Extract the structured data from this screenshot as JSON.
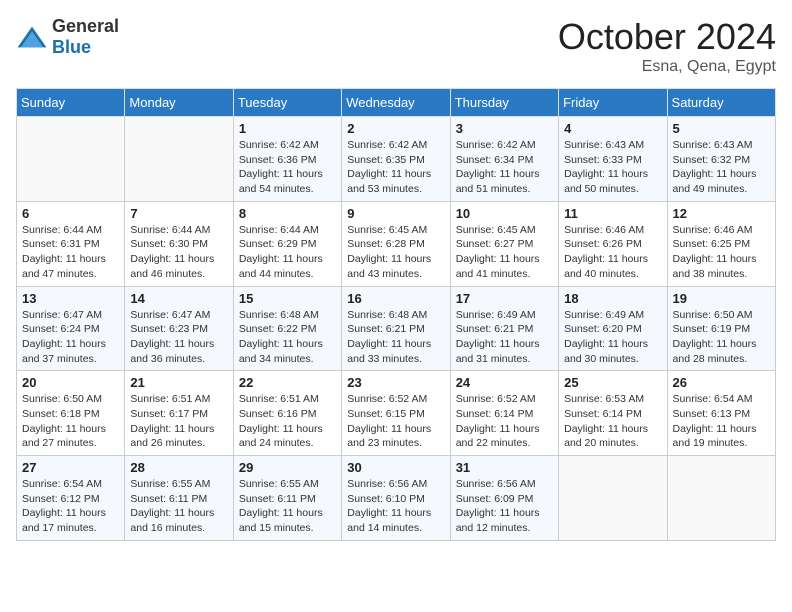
{
  "logo": {
    "general": "General",
    "blue": "Blue"
  },
  "header": {
    "month": "October 2024",
    "location": "Esna, Qena, Egypt"
  },
  "weekdays": [
    "Sunday",
    "Monday",
    "Tuesday",
    "Wednesday",
    "Thursday",
    "Friday",
    "Saturday"
  ],
  "weeks": [
    [
      {
        "day": "",
        "sunrise": "",
        "sunset": "",
        "daylight": ""
      },
      {
        "day": "",
        "sunrise": "",
        "sunset": "",
        "daylight": ""
      },
      {
        "day": "1",
        "sunrise": "Sunrise: 6:42 AM",
        "sunset": "Sunset: 6:36 PM",
        "daylight": "Daylight: 11 hours and 54 minutes."
      },
      {
        "day": "2",
        "sunrise": "Sunrise: 6:42 AM",
        "sunset": "Sunset: 6:35 PM",
        "daylight": "Daylight: 11 hours and 53 minutes."
      },
      {
        "day": "3",
        "sunrise": "Sunrise: 6:42 AM",
        "sunset": "Sunset: 6:34 PM",
        "daylight": "Daylight: 11 hours and 51 minutes."
      },
      {
        "day": "4",
        "sunrise": "Sunrise: 6:43 AM",
        "sunset": "Sunset: 6:33 PM",
        "daylight": "Daylight: 11 hours and 50 minutes."
      },
      {
        "day": "5",
        "sunrise": "Sunrise: 6:43 AM",
        "sunset": "Sunset: 6:32 PM",
        "daylight": "Daylight: 11 hours and 49 minutes."
      }
    ],
    [
      {
        "day": "6",
        "sunrise": "Sunrise: 6:44 AM",
        "sunset": "Sunset: 6:31 PM",
        "daylight": "Daylight: 11 hours and 47 minutes."
      },
      {
        "day": "7",
        "sunrise": "Sunrise: 6:44 AM",
        "sunset": "Sunset: 6:30 PM",
        "daylight": "Daylight: 11 hours and 46 minutes."
      },
      {
        "day": "8",
        "sunrise": "Sunrise: 6:44 AM",
        "sunset": "Sunset: 6:29 PM",
        "daylight": "Daylight: 11 hours and 44 minutes."
      },
      {
        "day": "9",
        "sunrise": "Sunrise: 6:45 AM",
        "sunset": "Sunset: 6:28 PM",
        "daylight": "Daylight: 11 hours and 43 minutes."
      },
      {
        "day": "10",
        "sunrise": "Sunrise: 6:45 AM",
        "sunset": "Sunset: 6:27 PM",
        "daylight": "Daylight: 11 hours and 41 minutes."
      },
      {
        "day": "11",
        "sunrise": "Sunrise: 6:46 AM",
        "sunset": "Sunset: 6:26 PM",
        "daylight": "Daylight: 11 hours and 40 minutes."
      },
      {
        "day": "12",
        "sunrise": "Sunrise: 6:46 AM",
        "sunset": "Sunset: 6:25 PM",
        "daylight": "Daylight: 11 hours and 38 minutes."
      }
    ],
    [
      {
        "day": "13",
        "sunrise": "Sunrise: 6:47 AM",
        "sunset": "Sunset: 6:24 PM",
        "daylight": "Daylight: 11 hours and 37 minutes."
      },
      {
        "day": "14",
        "sunrise": "Sunrise: 6:47 AM",
        "sunset": "Sunset: 6:23 PM",
        "daylight": "Daylight: 11 hours and 36 minutes."
      },
      {
        "day": "15",
        "sunrise": "Sunrise: 6:48 AM",
        "sunset": "Sunset: 6:22 PM",
        "daylight": "Daylight: 11 hours and 34 minutes."
      },
      {
        "day": "16",
        "sunrise": "Sunrise: 6:48 AM",
        "sunset": "Sunset: 6:21 PM",
        "daylight": "Daylight: 11 hours and 33 minutes."
      },
      {
        "day": "17",
        "sunrise": "Sunrise: 6:49 AM",
        "sunset": "Sunset: 6:21 PM",
        "daylight": "Daylight: 11 hours and 31 minutes."
      },
      {
        "day": "18",
        "sunrise": "Sunrise: 6:49 AM",
        "sunset": "Sunset: 6:20 PM",
        "daylight": "Daylight: 11 hours and 30 minutes."
      },
      {
        "day": "19",
        "sunrise": "Sunrise: 6:50 AM",
        "sunset": "Sunset: 6:19 PM",
        "daylight": "Daylight: 11 hours and 28 minutes."
      }
    ],
    [
      {
        "day": "20",
        "sunrise": "Sunrise: 6:50 AM",
        "sunset": "Sunset: 6:18 PM",
        "daylight": "Daylight: 11 hours and 27 minutes."
      },
      {
        "day": "21",
        "sunrise": "Sunrise: 6:51 AM",
        "sunset": "Sunset: 6:17 PM",
        "daylight": "Daylight: 11 hours and 26 minutes."
      },
      {
        "day": "22",
        "sunrise": "Sunrise: 6:51 AM",
        "sunset": "Sunset: 6:16 PM",
        "daylight": "Daylight: 11 hours and 24 minutes."
      },
      {
        "day": "23",
        "sunrise": "Sunrise: 6:52 AM",
        "sunset": "Sunset: 6:15 PM",
        "daylight": "Daylight: 11 hours and 23 minutes."
      },
      {
        "day": "24",
        "sunrise": "Sunrise: 6:52 AM",
        "sunset": "Sunset: 6:14 PM",
        "daylight": "Daylight: 11 hours and 22 minutes."
      },
      {
        "day": "25",
        "sunrise": "Sunrise: 6:53 AM",
        "sunset": "Sunset: 6:14 PM",
        "daylight": "Daylight: 11 hours and 20 minutes."
      },
      {
        "day": "26",
        "sunrise": "Sunrise: 6:54 AM",
        "sunset": "Sunset: 6:13 PM",
        "daylight": "Daylight: 11 hours and 19 minutes."
      }
    ],
    [
      {
        "day": "27",
        "sunrise": "Sunrise: 6:54 AM",
        "sunset": "Sunset: 6:12 PM",
        "daylight": "Daylight: 11 hours and 17 minutes."
      },
      {
        "day": "28",
        "sunrise": "Sunrise: 6:55 AM",
        "sunset": "Sunset: 6:11 PM",
        "daylight": "Daylight: 11 hours and 16 minutes."
      },
      {
        "day": "29",
        "sunrise": "Sunrise: 6:55 AM",
        "sunset": "Sunset: 6:11 PM",
        "daylight": "Daylight: 11 hours and 15 minutes."
      },
      {
        "day": "30",
        "sunrise": "Sunrise: 6:56 AM",
        "sunset": "Sunset: 6:10 PM",
        "daylight": "Daylight: 11 hours and 14 minutes."
      },
      {
        "day": "31",
        "sunrise": "Sunrise: 6:56 AM",
        "sunset": "Sunset: 6:09 PM",
        "daylight": "Daylight: 11 hours and 12 minutes."
      },
      {
        "day": "",
        "sunrise": "",
        "sunset": "",
        "daylight": ""
      },
      {
        "day": "",
        "sunrise": "",
        "sunset": "",
        "daylight": ""
      }
    ]
  ]
}
